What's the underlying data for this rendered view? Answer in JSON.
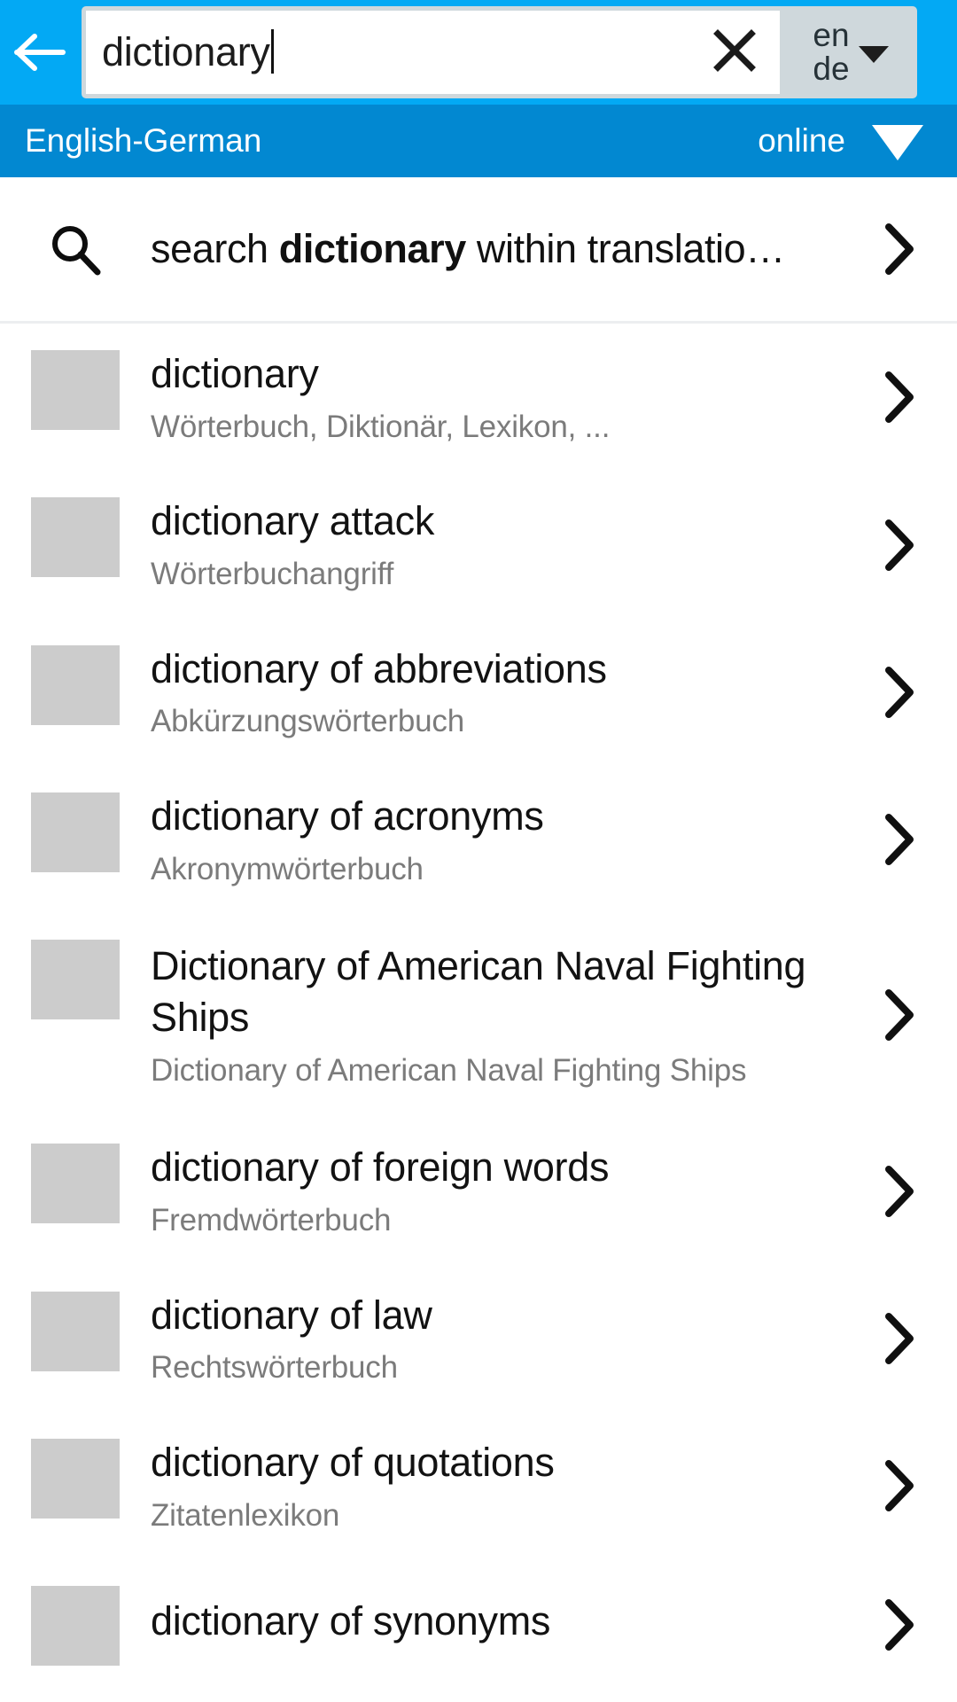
{
  "toolbar": {
    "back_icon": "arrow-left-icon",
    "search_value": "dictionary",
    "clear_icon": "close-icon",
    "lang_source": "en",
    "lang_target": "de",
    "dropdown_icon": "caret-down-icon",
    "bg_color": "#03a9f4",
    "field_frame_color": "#cfd8dc"
  },
  "subbar": {
    "dictionary_pair": "English-German",
    "status": "online",
    "status_icon": "wifi-icon",
    "bg_color": "#0288d1"
  },
  "search_within": {
    "icon": "search-icon",
    "prefix": "search ",
    "term": "dictionary",
    "suffix": " within translatio…",
    "chevron_icon": "chevron-right-icon"
  },
  "results": {
    "thumb_color": "#cccccc",
    "chevron_icon": "chevron-right-icon",
    "items": [
      {
        "title": "dictionary",
        "subtitle": "Wörterbuch, Diktionär, Lexikon, ..."
      },
      {
        "title": "dictionary attack",
        "subtitle": "Wörterbuchangriff"
      },
      {
        "title": "dictionary of abbreviations",
        "subtitle": "Abkürzungswörterbuch"
      },
      {
        "title": "dictionary of acronyms",
        "subtitle": "Akronymwörterbuch"
      },
      {
        "title": "Dictionary of American Naval Fighting Ships",
        "subtitle": "Dictionary of American Naval Fighting Ships"
      },
      {
        "title": "dictionary of foreign words",
        "subtitle": "Fremdwörterbuch"
      },
      {
        "title": "dictionary of law",
        "subtitle": "Rechtswörterbuch"
      },
      {
        "title": "dictionary of quotations",
        "subtitle": "Zitatenlexikon"
      },
      {
        "title": "dictionary of synonyms",
        "subtitle": ""
      }
    ]
  }
}
